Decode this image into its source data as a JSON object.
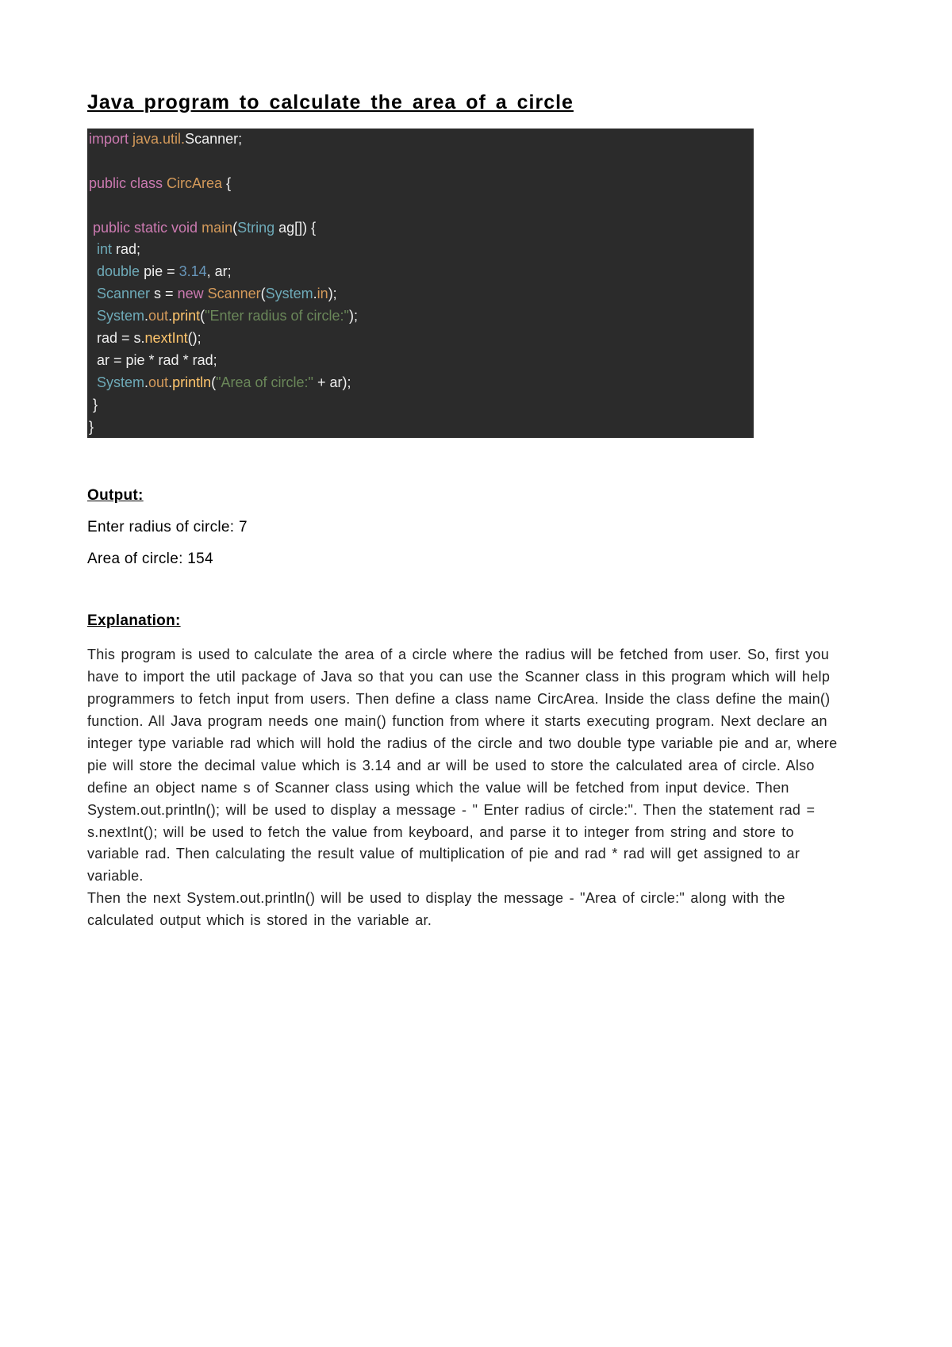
{
  "title": "Java program to calculate the area of a circle",
  "code": {
    "line1": {
      "import": "import",
      "pkg": " java.util.",
      "cls": "Scanner",
      "semi": ";"
    },
    "line3": {
      "kw1": "public class ",
      "cls": "CircArea",
      "brace": " {"
    },
    "line5": {
      "kw": " public static void ",
      "main": "main",
      "paren1": "(",
      "str": "String",
      "arg": " ag[]) {"
    },
    "line6": {
      "type": "  int ",
      "id": "rad",
      "semi": ";"
    },
    "line7": {
      "type": "  double ",
      "id1": "pie = ",
      "num": "3.14",
      "rest": ", ar;"
    },
    "line8": {
      "cls": "  Scanner ",
      "id": "s = ",
      "kw": "new ",
      "cls2": "Scanner",
      "paren": "(",
      "sys": "System",
      "dot": ".",
      "in": "in",
      "close": ");"
    },
    "line9": {
      "sys": "  System",
      "dot1": ".",
      "out": "out",
      "dot2": ".",
      "print": "print",
      "paren": "(",
      "str": "\"Enter radius of circle:\"",
      "close": ");"
    },
    "line10": {
      "text": "  rad = s.",
      "method": "nextInt",
      "close": "();"
    },
    "line11": {
      "text": "  ar = pie * rad * rad;"
    },
    "line12": {
      "sys": "  System",
      "dot1": ".",
      "out": "out",
      "dot2": ".",
      "print": "println",
      "paren": "(",
      "str": "\"Area of circle:\"",
      "plus": " + ar);"
    },
    "line13": {
      "brace": " }"
    },
    "line14": {
      "brace": "}"
    }
  },
  "output_heading": "Output:",
  "output_lines": [
    "Enter radius of circle: 7",
    "Area of circle: 154"
  ],
  "explanation_heading": "Explanation:",
  "explanation_p1": "This program is used to calculate the area of a circle where the radius will be fetched from user. So, first you have to import the util package of Java so that you can use the Scanner class in this program which will help programmers to fetch input from users. Then define a class name CircArea. Inside the class define the main() function. All Java program needs one main() function from where it starts executing program. Next declare an integer type variable rad which will hold the radius of the circle and two double type variable pie and ar, where pie will store the decimal value which is 3.14 and ar will be used to store the calculated area of circle. Also define an object name s of Scanner class using which the value will be fetched from input device. Then System.out.println(); will be used to display a message - \" Enter radius of circle:\". Then the statement rad = s.nextInt(); will be used to fetch the value from keyboard, and parse it to integer from string and store to variable rad. Then calculating the result value of multiplication of pie and rad * rad will get assigned to ar variable.",
  "explanation_p2": "Then the next System.out.println() will be used to display the message - \"Area of circle:\" along with the calculated output which is stored in the variable ar."
}
